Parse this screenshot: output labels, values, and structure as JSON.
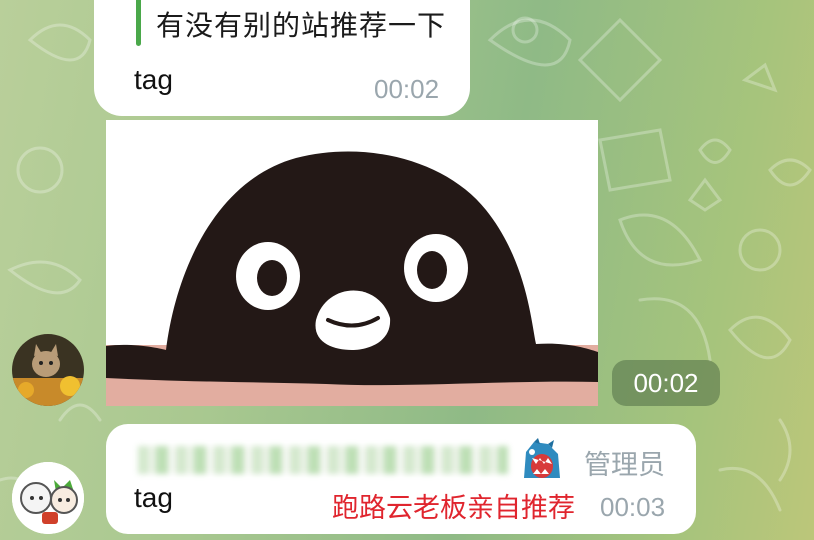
{
  "messages": [
    {
      "quote": "有没有别的站推荐一下",
      "text": "tag",
      "time": "00:02"
    },
    {
      "type": "sticker",
      "sticker_icon": "penguin-face-sticker",
      "time": "00:02"
    },
    {
      "sender_role": "管理员",
      "text": "tag",
      "title": "跑路云老板亲自推荐",
      "time": "00:03"
    }
  ],
  "colors": {
    "quote_bar": "#4aa84a",
    "title_red": "#e0252e",
    "time_gray": "#9aa6ad",
    "bubble": "#ffffff"
  }
}
